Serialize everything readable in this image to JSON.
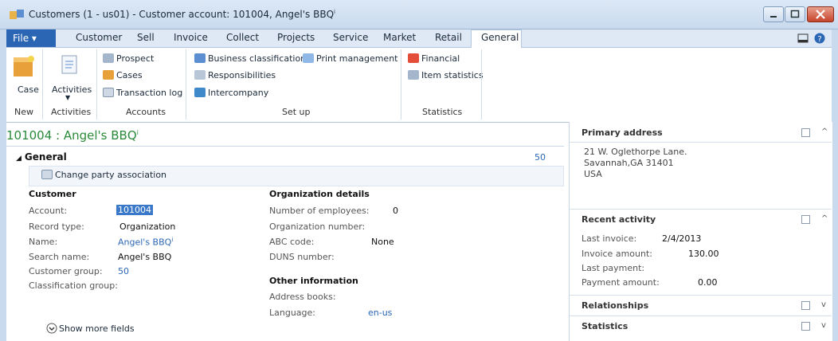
{
  "window": {
    "title": "Customers (1 - us01) - Customer account: 101004, Angel's BBQ",
    "title_mark": "i"
  },
  "tabs": {
    "file": "File",
    "items": [
      "Customer",
      "Sell",
      "Invoice",
      "Collect",
      "Projects",
      "Service",
      "Market",
      "Retail",
      "General"
    ],
    "active": "General"
  },
  "ribbon": {
    "new": {
      "button": "Case",
      "label": "New"
    },
    "activities": {
      "button": "Activities",
      "label": "Activities"
    },
    "accounts": {
      "items": [
        "Prospect",
        "Cases",
        "Transaction log"
      ],
      "label": "Accounts"
    },
    "setup": {
      "items": [
        "Business classification",
        "Print management",
        "Responsibilities",
        "Intercompany"
      ],
      "label": "Set up"
    },
    "statistics": {
      "items": [
        "Financial",
        "Item statistics"
      ],
      "label": "Statistics"
    }
  },
  "record": {
    "title": "101004 : Angel's BBQ",
    "title_mark": "i"
  },
  "general": {
    "header": "General",
    "count": "50",
    "change_party": "Change party association",
    "customer": {
      "heading": "Customer",
      "labels": [
        "Account:",
        "Record type:",
        "Name:",
        "Search name:",
        "Customer group:",
        "Classification group:"
      ],
      "account": "101004",
      "record_type": "Organization",
      "name": "Angel's BBQ",
      "name_mark": "i",
      "search_name": "Angel's BBQ",
      "customer_group": "50"
    },
    "org": {
      "heading": "Organization details",
      "labels": [
        "Number of employees:",
        "Organization number:",
        "ABC code:",
        "DUNS number:"
      ],
      "employees": "0",
      "abc": "None"
    },
    "other": {
      "heading": "Other information",
      "labels": [
        "Address books:",
        "Language:"
      ],
      "language": "en-us"
    },
    "show_more": "Show more fields"
  },
  "factbox": {
    "primary_address": {
      "header": "Primary address",
      "lines": [
        "21 W. Oglethorpe Lane.",
        "Savannah,GA 31401",
        "USA"
      ]
    },
    "recent_activity": {
      "header": "Recent activity",
      "labels": [
        "Last invoice:",
        "Invoice amount:",
        "Last payment:",
        "Payment amount:"
      ],
      "last_invoice": "2/4/2013",
      "invoice_amount": "130.00",
      "payment_amount": "0.00"
    },
    "relationships": "Relationships",
    "statistics": "Statistics"
  },
  "colors": {
    "accent": "#2b66b5",
    "record_title": "#2a8a3a",
    "close": "#c6432b"
  }
}
